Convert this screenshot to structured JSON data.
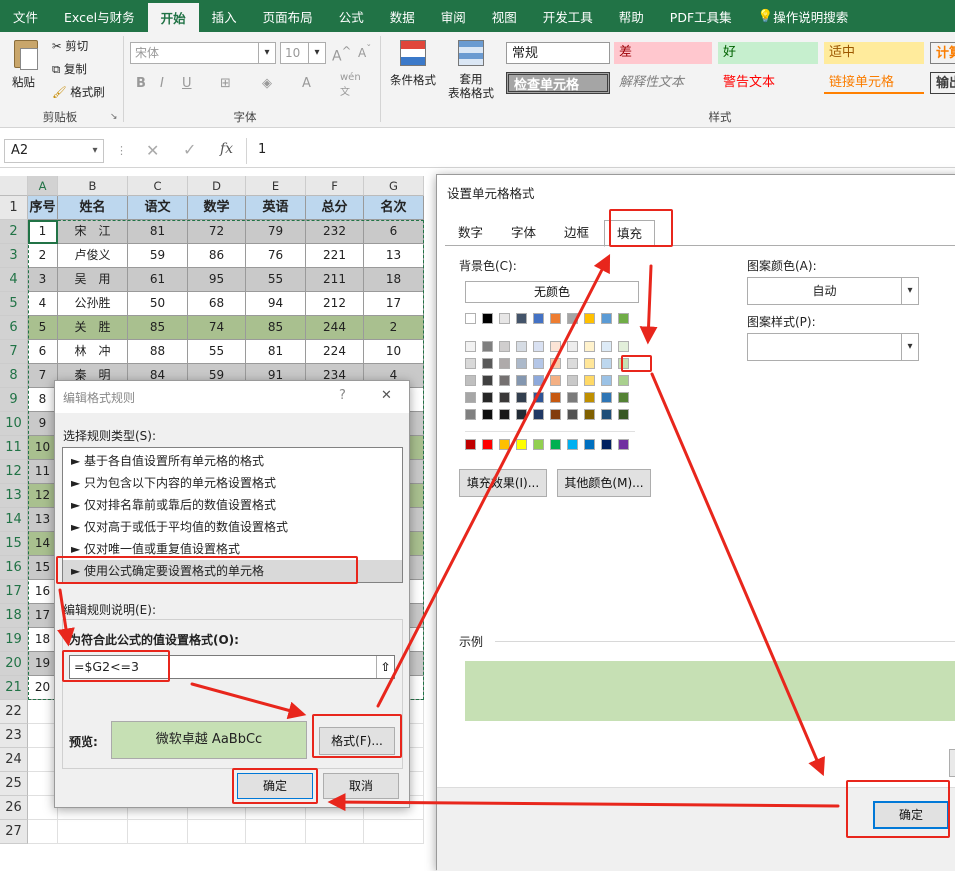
{
  "ribbon": {
    "tabs": [
      "文件",
      "Excel与财务",
      "开始",
      "插入",
      "页面布局",
      "公式",
      "数据",
      "审阅",
      "视图",
      "开发工具",
      "帮助",
      "PDF工具集",
      "操作说明搜索"
    ],
    "active_tab": "开始",
    "clipboard": {
      "paste": "粘贴",
      "cut": "剪切",
      "copy": "复制",
      "format_painter": "格式刷",
      "label": "剪贴板"
    },
    "font": {
      "name": "宋体",
      "size": "10",
      "label": "字体",
      "wen": "wén"
    },
    "cond_format": "条件格式",
    "table_format": "套用\n表格格式",
    "styles": {
      "label": "样式",
      "normal": "常规",
      "bad": "差",
      "good": "好",
      "neutral": "适中",
      "calc": "计算",
      "check": "检查单元格",
      "explain": "解释性文本",
      "warning": "警告文本",
      "link": "链接单元格",
      "output": "输出"
    }
  },
  "formula_bar": {
    "cell_ref": "A2",
    "value": "1",
    "fx": "fx"
  },
  "sheet": {
    "col_letters": [
      "A",
      "B",
      "C",
      "D",
      "E",
      "F",
      "G"
    ],
    "row_numbers": [
      "1",
      "2",
      "3",
      "4",
      "5",
      "6",
      "7",
      "8",
      "9",
      "10",
      "11",
      "12",
      "13",
      "14",
      "15",
      "16",
      "17",
      "18",
      "19",
      "20",
      "21",
      "22",
      "23",
      "24",
      "25",
      "26",
      "27"
    ],
    "headers": [
      "序号",
      "姓名",
      "语文",
      "数学",
      "英语",
      "总分",
      "名次"
    ],
    "rows": [
      [
        "1",
        "宋　江",
        "81",
        "72",
        "79",
        "232",
        "6"
      ],
      [
        "2",
        "卢俊义",
        "59",
        "86",
        "76",
        "221",
        "13"
      ],
      [
        "3",
        "吴　用",
        "61",
        "95",
        "55",
        "211",
        "18"
      ],
      [
        "4",
        "公孙胜",
        "50",
        "68",
        "94",
        "212",
        "17"
      ],
      [
        "5",
        "关　胜",
        "85",
        "74",
        "85",
        "244",
        "2"
      ],
      [
        "6",
        "林　冲",
        "88",
        "55",
        "81",
        "224",
        "10"
      ],
      [
        "7",
        "秦　明",
        "84",
        "59",
        "91",
        "234",
        "4"
      ],
      [
        "8",
        "",
        "",
        "",
        "",
        "",
        ""
      ],
      [
        "9",
        "",
        "",
        "",
        "",
        "",
        ""
      ],
      [
        "10",
        "",
        "",
        "",
        "",
        "",
        ""
      ],
      [
        "11",
        "",
        "",
        "",
        "",
        "",
        ""
      ],
      [
        "12",
        "",
        "",
        "",
        "",
        "",
        ""
      ],
      [
        "13",
        "",
        "",
        "",
        "",
        "",
        ""
      ],
      [
        "14",
        "",
        "",
        "",
        "",
        "",
        ""
      ],
      [
        "15",
        "",
        "",
        "",
        "",
        "",
        ""
      ],
      [
        "16",
        "",
        "",
        "",
        "",
        "",
        ""
      ],
      [
        "17",
        "",
        "",
        "",
        "",
        "",
        ""
      ],
      [
        "18",
        "",
        "",
        "",
        "",
        "",
        ""
      ],
      [
        "19",
        "",
        "",
        "",
        "",
        "",
        ""
      ],
      [
        "20",
        "",
        "",
        "",
        "",
        "",
        ""
      ]
    ]
  },
  "rule_dialog": {
    "title": "编辑格式规则",
    "help": "?",
    "close": "✕",
    "select_label": "选择规则类型(S):",
    "rule_types": [
      "► 基于各自值设置所有单元格的格式",
      "► 只为包含以下内容的单元格设置格式",
      "► 仅对排名靠前或靠后的数值设置格式",
      "► 仅对高于或低于平均值的数值设置格式",
      "► 仅对唯一值或重复值设置格式",
      "► 使用公式确定要设置格式的单元格"
    ],
    "desc_label": "编辑规则说明(E):",
    "formula_label": "为符合此公式的值设置格式(O):",
    "formula": "=$G2<=3",
    "preview_label": "预览:",
    "preview_text": "微软卓越  AaBbCc",
    "format_btn": "格式(F)...",
    "ok": "确定",
    "cancel": "取消"
  },
  "cell_dialog": {
    "title": "设置单元格格式",
    "tabs": [
      "数字",
      "字体",
      "边框",
      "填充"
    ],
    "bg_label": "背景色(C):",
    "no_color": "无颜色",
    "pattern_color_label": "图案颜色(A):",
    "pattern_color": "自动",
    "pattern_style_label": "图案样式(P):",
    "fill_effects": "填充效果(I)...",
    "more_colors": "其他颜色(M)...",
    "sample_label": "示例",
    "ok": "确定",
    "sample_color": "#c6e0b4"
  },
  "colors": {
    "excel_green": "#217346",
    "header_blue": "#bdd7ee",
    "row_gray": "#c9c9c9",
    "row_green": "#a9c08f",
    "preview_green": "#c6e0b4",
    "annotation_red": "#e8261c"
  }
}
